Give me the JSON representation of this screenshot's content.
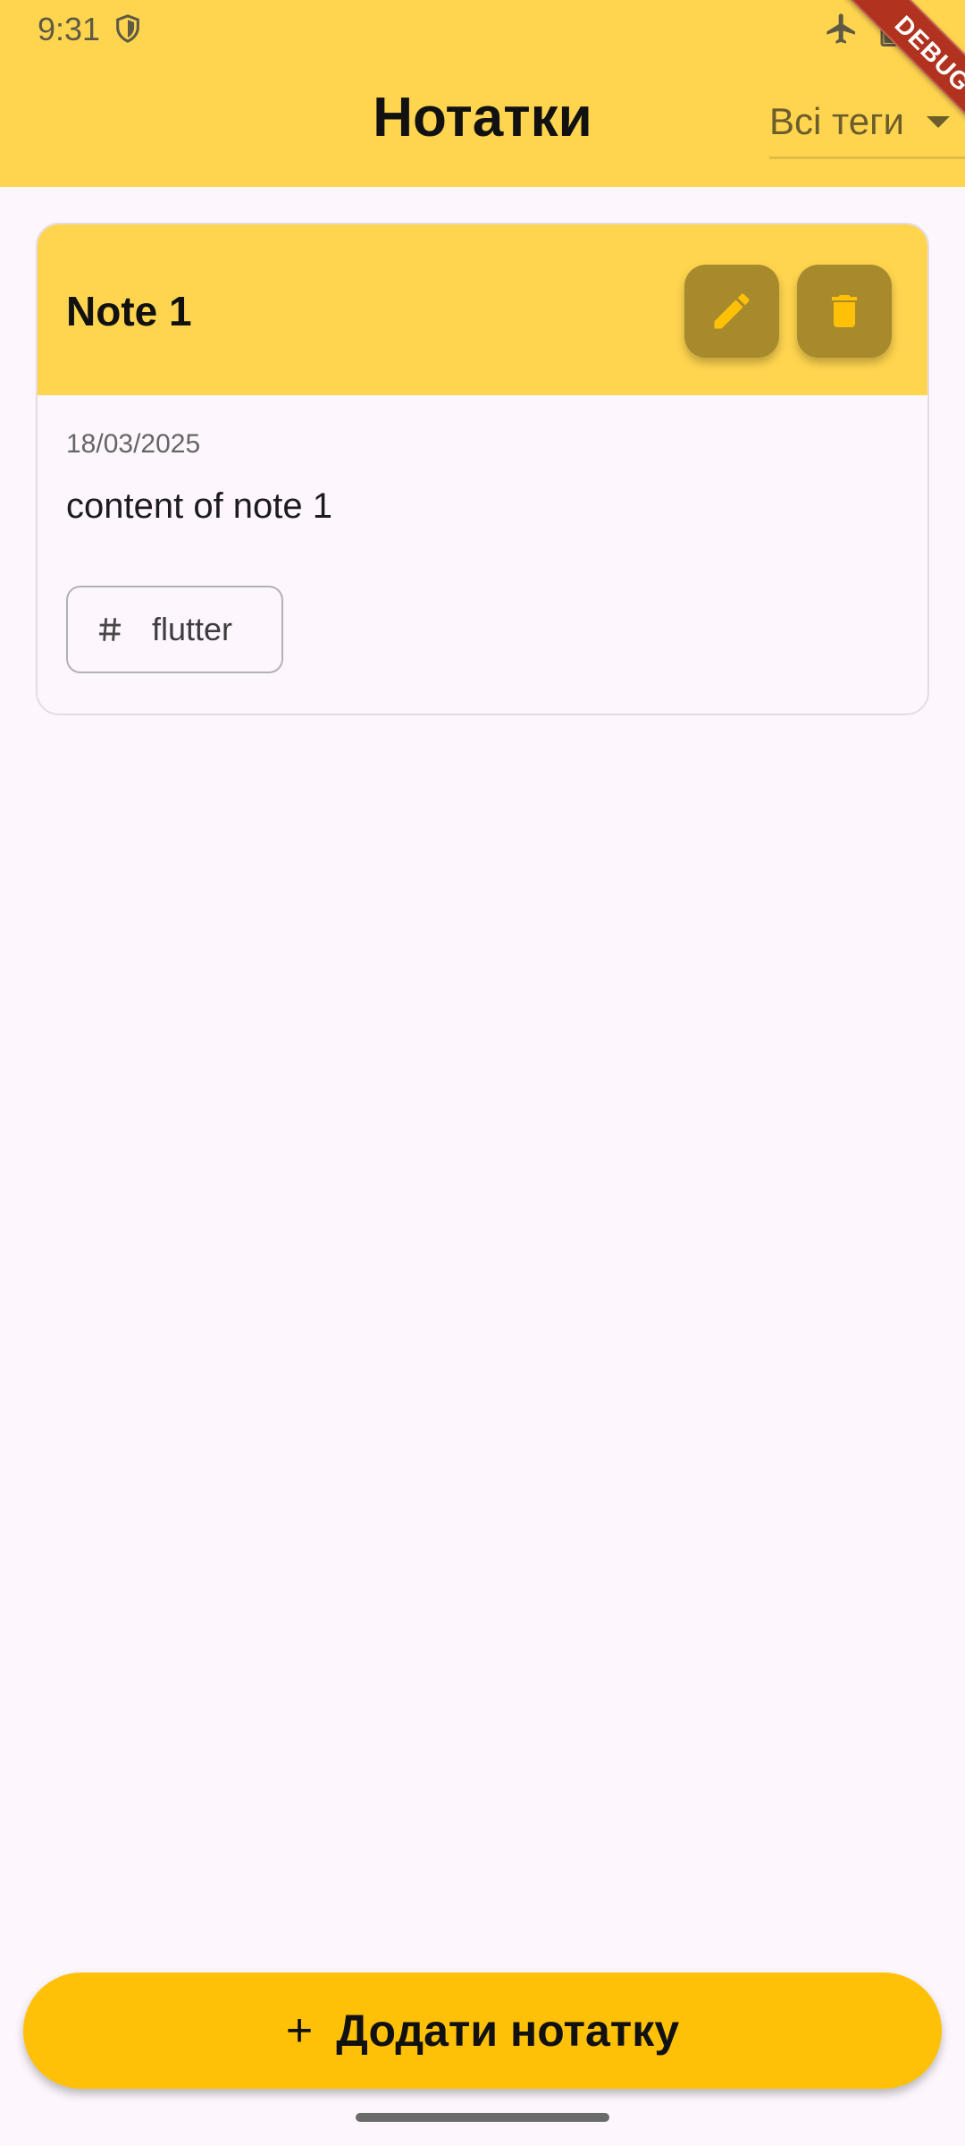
{
  "status_bar": {
    "time": "9:31",
    "icons": [
      "shield-icon",
      "airplane-mode-icon",
      "battery-icon"
    ]
  },
  "app_bar": {
    "title": "Нотатки",
    "tag_filter": {
      "selected": "Всі теги"
    }
  },
  "debug_banner": "DEBUG",
  "notes": [
    {
      "title": "Note 1",
      "date": "18/03/2025",
      "content": "content of note 1",
      "tags": [
        "flutter"
      ],
      "actions": [
        "pencil-icon",
        "trash-icon"
      ]
    }
  ],
  "add_button": {
    "label": "Додати нотатку",
    "icon": "plus-icon"
  },
  "colors": {
    "app_bar": "#FFD54F",
    "accent": "#FFC107",
    "icon_button_bg": "#A78A2C",
    "background": "#FDF7FD",
    "debug_ribbon": "#B1321E"
  }
}
